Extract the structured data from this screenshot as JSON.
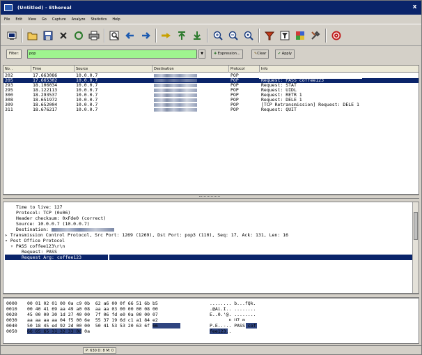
{
  "window": {
    "title": "(Untitled) - Ethereal",
    "close_glyph": "x"
  },
  "menu": [
    "File",
    "Edit",
    "View",
    "Go",
    "Capture",
    "Analyze",
    "Statistics",
    "Help"
  ],
  "toolbar": {
    "icons": [
      "list-interfaces-icon",
      "open-icon",
      "save-icon",
      "close-file-icon",
      "reload-icon",
      "print-icon",
      "find-packet-icon",
      "go-back-icon",
      "go-forward-icon",
      "go-to-packet-icon",
      "go-first-icon",
      "go-last-icon",
      "zoom-in-icon",
      "zoom-out-icon",
      "normal-size-icon",
      "capture-filters-icon",
      "display-filters-icon",
      "coloring-rules-icon",
      "preferences-icon",
      "help-icon"
    ]
  },
  "filter": {
    "label": "Filter:",
    "value": "pop",
    "expression_label": "Expression...",
    "clear_label": "Clear",
    "apply_label": "Apply"
  },
  "packet_list": {
    "columns": [
      "No. .",
      "Time",
      "Source",
      "Destination",
      "Protocol",
      "Info"
    ],
    "rows": [
      {
        "no": "202",
        "time": "17.663086",
        "source": "10.0.0.7",
        "protocol": "POP",
        "info": "Request: USER emailtest",
        "selected": false
      },
      {
        "no": "205",
        "time": "17.665302",
        "source": "10.0.0.7",
        "protocol": "POP",
        "info": "Request: PASS coffee123",
        "selected": true
      },
      {
        "no": "293",
        "time": "18.106034",
        "source": "10.0.0.7",
        "protocol": "POP",
        "info": "Request: STAT",
        "selected": false
      },
      {
        "no": "295",
        "time": "18.122113",
        "source": "10.0.0.7",
        "protocol": "POP",
        "info": "Request: UIDL",
        "selected": false
      },
      {
        "no": "300",
        "time": "18.293537",
        "source": "10.0.0.7",
        "protocol": "POP",
        "info": "Request: RETR 1",
        "selected": false
      },
      {
        "no": "308",
        "time": "18.651972",
        "source": "10.0.0.7",
        "protocol": "POP",
        "info": "Request: DELE 1",
        "selected": false
      },
      {
        "no": "309",
        "time": "18.652004",
        "source": "10.0.0.7",
        "protocol": "POP",
        "info": "[TCP Retransmission] Request: DELE 1",
        "selected": false
      },
      {
        "no": "311",
        "time": "18.676217",
        "source": "10.0.0.7",
        "protocol": "POP",
        "info": "Request: QUIT",
        "selected": false
      }
    ]
  },
  "details": {
    "lines": [
      {
        "text": "Time to live: 127",
        "indent": 2,
        "selected": false,
        "blur": false
      },
      {
        "text": "Protocol: TCP (0x06)",
        "indent": 2,
        "selected": false,
        "blur": false
      },
      {
        "text": "Header checksum: 0xFde0 (correct)",
        "indent": 2,
        "selected": false,
        "blur": false
      },
      {
        "text": "Source: 10.0.0.7 (10.0.0.7)",
        "indent": 2,
        "selected": false,
        "blur": false
      },
      {
        "text": "Destination: ",
        "indent": 2,
        "selected": false,
        "blur": true
      },
      {
        "text": "Transmission Control Protocol, Src Port: 1269 (1269), Dst Port: pop3 (110), Seq: 17, Ack: 131, Len: 16",
        "indent": 0,
        "marker": ">",
        "selected": false,
        "blur": false
      },
      {
        "text": "Post Office Protocol",
        "indent": 0,
        "marker": "v",
        "selected": false,
        "blur": false
      },
      {
        "text": "PASS coffee123\\r\\n",
        "indent": 1,
        "marker": "v",
        "selected": false,
        "blur": false
      },
      {
        "text": "Request: PASS",
        "indent": 3,
        "selected": false,
        "blur": false
      },
      {
        "text": "Request Arg: coffee123",
        "indent": 3,
        "selected": true,
        "blur": false
      }
    ]
  },
  "hex": {
    "lines": [
      {
        "offset": "0000",
        "bytes": "00 01 02 01 00 0a c9 0b  62 a6 00 0f 66 51 6b b5",
        "ascii": "........ b...fQk."
      },
      {
        "offset": "0010",
        "bytes": "00 40 41 69 aa 49 a0 08  aa aa 03 00 00 00 08 00",
        "ascii": ".@Ai.I.. ........"
      },
      {
        "offset": "0020",
        "bytes": "45 00 00 30 1d 27 40 00  7f 06 fd e0 0a 00 00 07",
        "ascii": "E..0.'@. ........"
      },
      {
        "offset": "0030",
        "bytes": "aa aa aa aa 04 f5 00 6e  55 37 19 6d c1 a1 84 e2",
        "ascii": ".......n U7.m...."
      },
      {
        "offset": "0040",
        "bytes": "50 18 45 ed 92 2d 00 00  50 41 53 53 20 63 6f 66",
        "ascii": "P.E..-.. PASS cof"
      },
      {
        "offset": "0050",
        "bytes": "66 65 65 31 32 33 0d 0a",
        "ascii": "fee123.."
      }
    ]
  },
  "status": {
    "text": "P: 630 D: 8 M: 0"
  }
}
